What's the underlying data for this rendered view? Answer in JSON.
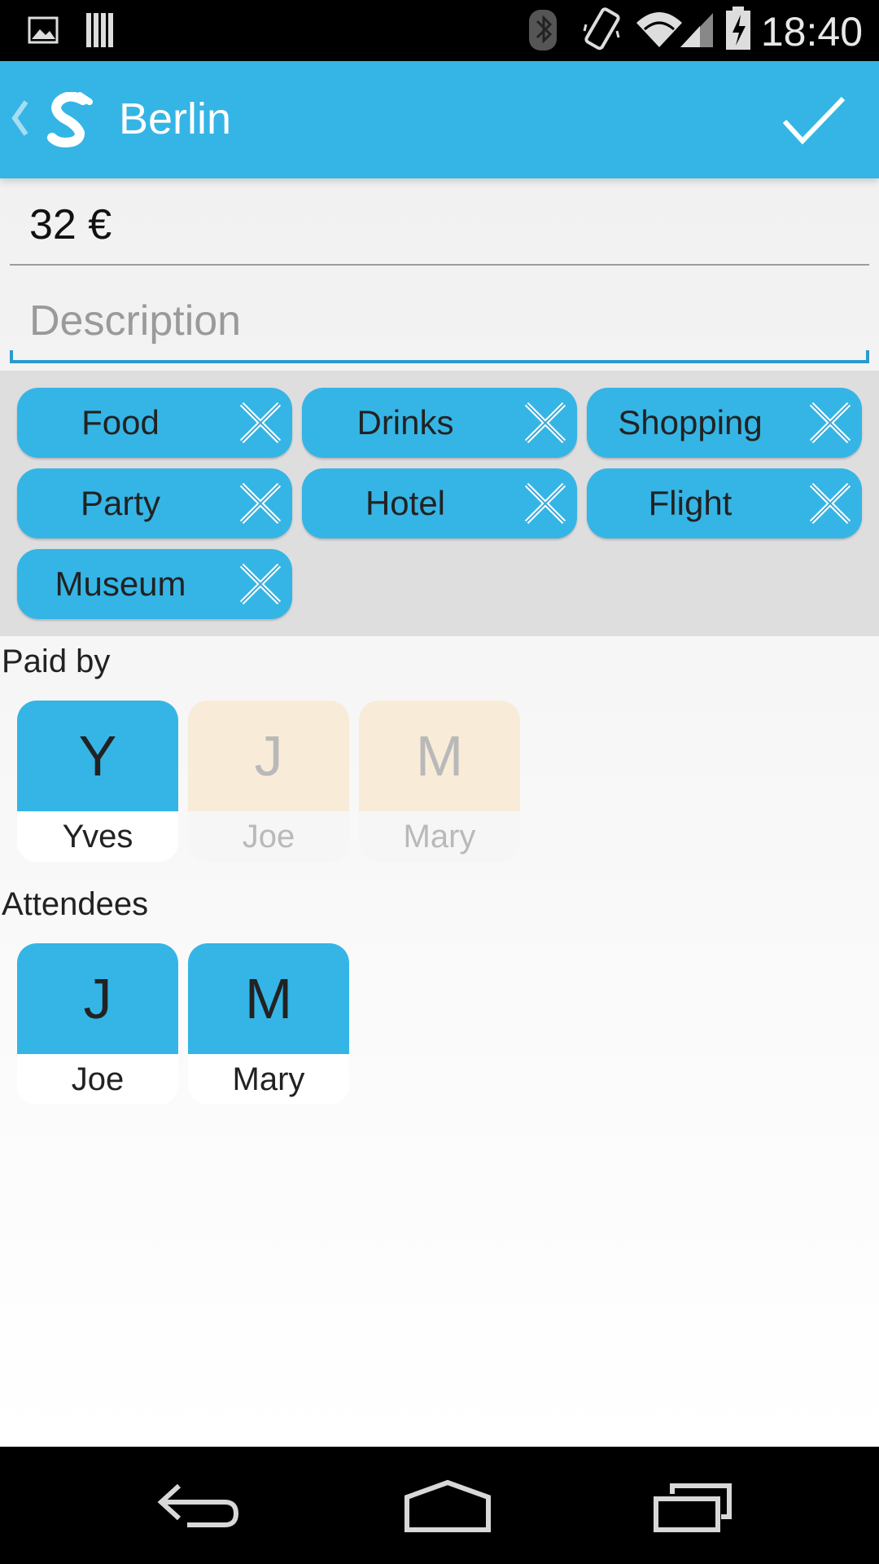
{
  "status_bar": {
    "time": "18:40",
    "icons": [
      "image-icon",
      "storage-icon",
      "bluetooth-icon",
      "vibrate-icon",
      "wifi-icon",
      "signal-icon",
      "battery-charging-icon"
    ]
  },
  "action_bar": {
    "title": "Berlin",
    "logo_icon": "splitwise-logo-icon",
    "done_icon": "checkmark-icon"
  },
  "form": {
    "amount_value": "32 €",
    "description_value": "",
    "description_placeholder": "Description"
  },
  "tags": [
    {
      "label": "Food"
    },
    {
      "label": "Drinks"
    },
    {
      "label": "Shopping"
    },
    {
      "label": "Party"
    },
    {
      "label": "Hotel"
    },
    {
      "label": "Flight"
    },
    {
      "label": "Museum"
    }
  ],
  "paid_by": {
    "label": "Paid by",
    "people": [
      {
        "initial": "Y",
        "name": "Yves",
        "selected": true
      },
      {
        "initial": "J",
        "name": "Joe",
        "selected": false
      },
      {
        "initial": "M",
        "name": "Mary",
        "selected": false
      }
    ]
  },
  "attendees": {
    "label": "Attendees",
    "people": [
      {
        "initial": "J",
        "name": "Joe",
        "selected": true
      },
      {
        "initial": "M",
        "name": "Mary",
        "selected": true
      }
    ]
  },
  "colors": {
    "accent": "#35b5e5",
    "inactive_tile": "#f8ecd9",
    "tags_background": "#dedede"
  },
  "nav_bar": {
    "icons": [
      "back-icon",
      "home-icon",
      "recent-apps-icon"
    ]
  }
}
